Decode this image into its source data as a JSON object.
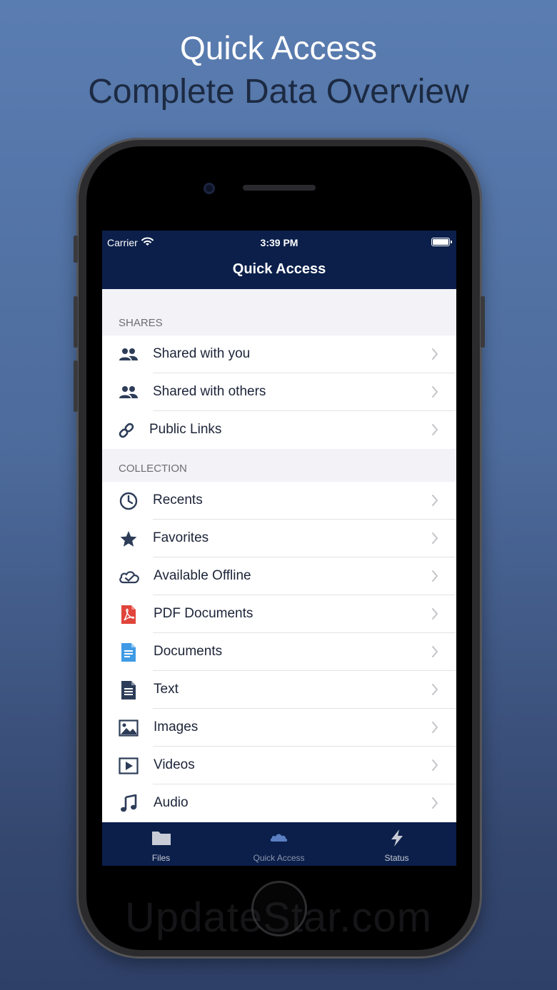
{
  "headline": {
    "line1": "Quick Access",
    "line2": "Complete Data Overview"
  },
  "watermark": "UpdateStar.com",
  "status_bar": {
    "carrier": "Carrier",
    "time": "3:39 PM",
    "icons": [
      "wifi-icon",
      "battery-icon"
    ]
  },
  "nav": {
    "title": "Quick Access"
  },
  "sections": {
    "shares": {
      "header": "SHARES",
      "items": [
        {
          "label": "Shared with you",
          "icon": "people-icon"
        },
        {
          "label": "Shared with others",
          "icon": "people-icon"
        },
        {
          "label": "Public Links",
          "icon": "link-icon"
        }
      ]
    },
    "collection": {
      "header": "COLLECTION",
      "items": [
        {
          "label": "Recents",
          "icon": "clock-icon"
        },
        {
          "label": "Favorites",
          "icon": "star-icon"
        },
        {
          "label": "Available Offline",
          "icon": "cloud-check-icon"
        },
        {
          "label": "PDF Documents",
          "icon": "pdf-icon"
        },
        {
          "label": "Documents",
          "icon": "document-icon"
        },
        {
          "label": "Text",
          "icon": "text-file-icon"
        },
        {
          "label": "Images",
          "icon": "image-icon"
        },
        {
          "label": "Videos",
          "icon": "video-icon"
        },
        {
          "label": "Audio",
          "icon": "music-note-icon"
        }
      ]
    }
  },
  "tabs": [
    {
      "label": "Files",
      "icon": "folder-icon",
      "active": false
    },
    {
      "label": "Quick Access",
      "icon": "cloud-icon",
      "active": true
    },
    {
      "label": "Status",
      "icon": "bolt-icon",
      "active": false
    }
  ],
  "colors": {
    "nav_background": "#0b1f4a",
    "icon_default": "#2d3c58",
    "pdf_red": "#e0443a",
    "document_blue": "#3f9be6"
  }
}
